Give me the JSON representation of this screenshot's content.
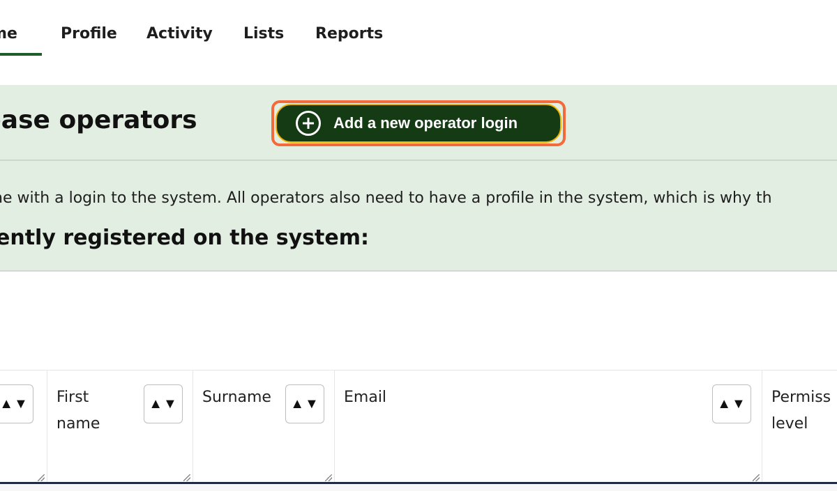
{
  "nav": {
    "items": [
      {
        "label": "ome",
        "active": true
      },
      {
        "label": "Profile"
      },
      {
        "label": "Activity"
      },
      {
        "label": "Lists"
      },
      {
        "label": "Reports"
      }
    ]
  },
  "header": {
    "title": "base operators",
    "add_button_label": "Add a new operator login",
    "add_button_icon": "plus-circle-icon"
  },
  "intro_text": "ne with a login to the system. All operators also need to have a profile in the system, which is why th",
  "subheading": "ently registered on the system:",
  "table": {
    "columns": [
      {
        "label": ""
      },
      {
        "label": "First name"
      },
      {
        "label": "Surname"
      },
      {
        "label": "Email"
      },
      {
        "label": "Permiss level"
      }
    ],
    "sort_glyph": "▲▼"
  },
  "colors": {
    "band": "#e3eee2",
    "button_bg": "#153b14",
    "highlight": "#f36b3a",
    "nav_active": "#1e5e2a"
  }
}
